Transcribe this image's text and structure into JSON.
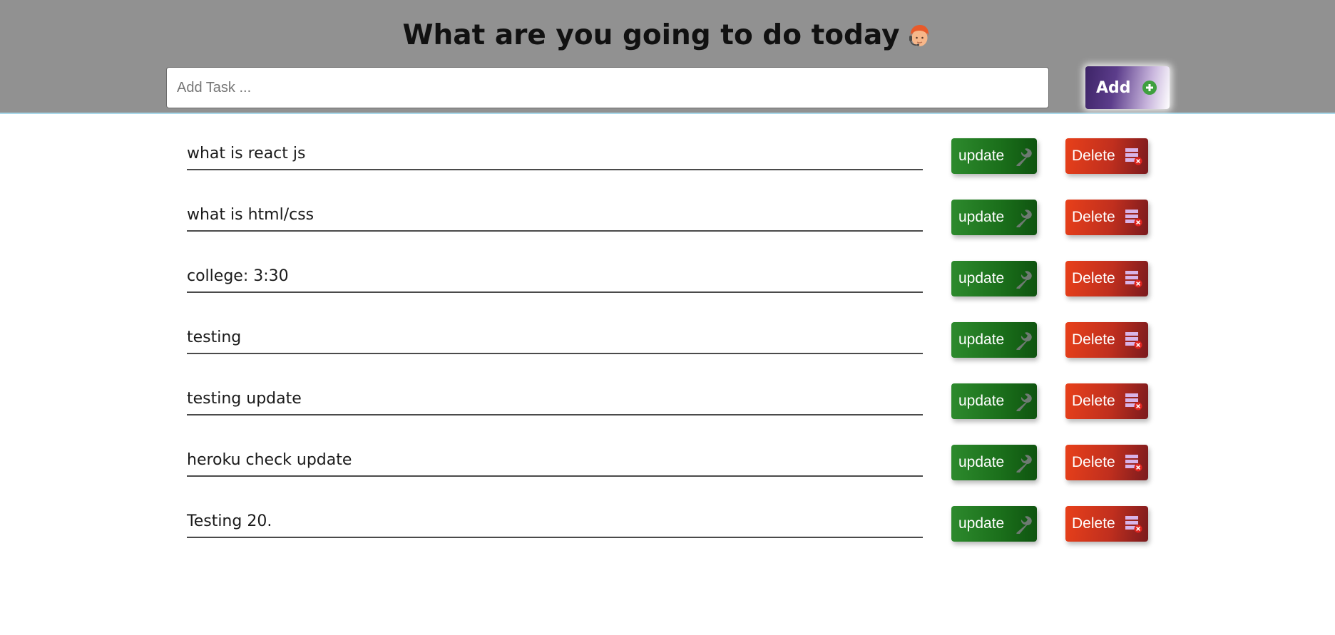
{
  "header": {
    "title": "What are you going to do today",
    "emoji_icon": "person-emoji-icon"
  },
  "input": {
    "placeholder": "Add Task ...",
    "value": ""
  },
  "add_button": {
    "label": "Add",
    "icon": "plus-circle-icon"
  },
  "tasks": [
    {
      "text": "what is react js",
      "update_label": "update",
      "delete_label": "Delete"
    },
    {
      "text": "what is html/css",
      "update_label": "update",
      "delete_label": "Delete"
    },
    {
      "text": "college: 3:30",
      "update_label": "update",
      "delete_label": "Delete"
    },
    {
      "text": "testing",
      "update_label": "update",
      "delete_label": "Delete"
    },
    {
      "text": "testing update",
      "update_label": "update",
      "delete_label": "Delete"
    },
    {
      "text": "heroku check update",
      "update_label": "update",
      "delete_label": "Delete"
    },
    {
      "text": "Testing 20.",
      "update_label": "update",
      "delete_label": "Delete"
    }
  ],
  "icons": {
    "update": "wrench-icon",
    "delete": "delete-row-icon"
  },
  "colors": {
    "header_bg": "#919191",
    "update_green": "#1a6e1a",
    "delete_red": "#c02f1e",
    "add_purple": "#3d2467"
  }
}
